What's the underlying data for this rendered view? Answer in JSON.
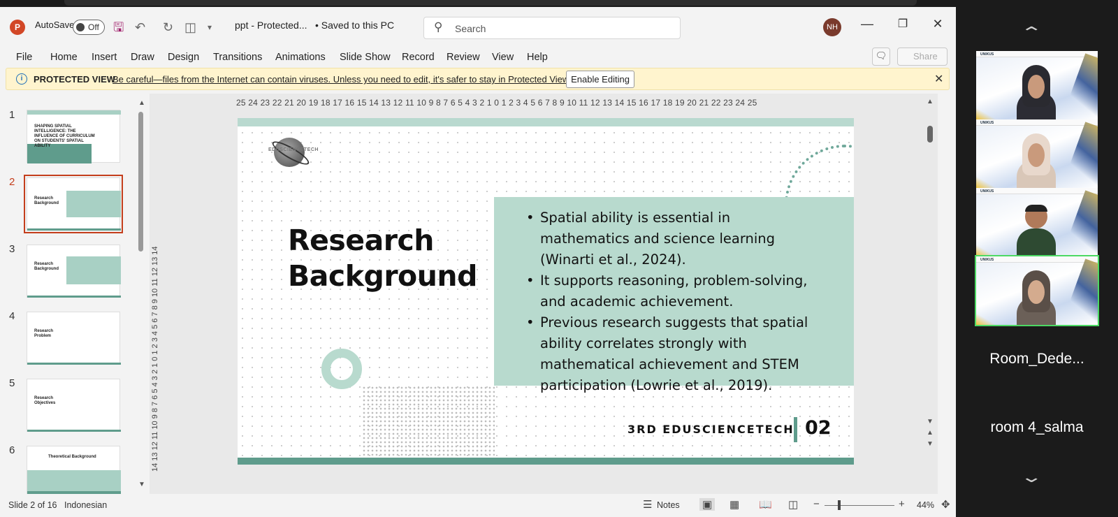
{
  "app": {
    "logo_letter": "P",
    "autosave_label": "AutoSave",
    "autosave_state": "Off",
    "filename": "ppt - Protected...",
    "save_status": "• Saved to this PC",
    "search_placeholder": "Search",
    "user_initials": "NH"
  },
  "ribbon": {
    "tabs": [
      "File",
      "Home",
      "Insert",
      "Draw",
      "Design",
      "Transitions",
      "Animations",
      "Slide Show",
      "Record",
      "Review",
      "View",
      "Help"
    ],
    "share_label": "Share"
  },
  "protected_bar": {
    "title": "PROTECTED VIEW",
    "message": "Be careful—files from the Internet can contain viruses. Unless you need to edit, it's safer to stay in Protected View.",
    "button": "Enable Editing"
  },
  "rulers": {
    "horizontal": "25 24 23 22 21 20 19 18 17 16 15 14 13 12 11 10 9 8 7 6 5 4 3 2 1 0 1 2 3 4 5 6 7 8 9 10 11 12 13 14 15 16 17 18 19 20 21 22 23 24 25",
    "vertical": "14 13 12 11 10 9 8 7 6 5 4 3 2 1 0 1 2 3 4 5 6 7 8 9 10 11 12 13 14"
  },
  "thumbnails": [
    {
      "num": "1",
      "title": "SHAPING SPATIAL INTELLIGENCE: THE INFLUENCE OF CURRICULUM ON STUDENTS' SPATIAL ABILITY",
      "selected": false
    },
    {
      "num": "2",
      "title": "Research Background",
      "selected": true
    },
    {
      "num": "3",
      "title": "Research Background",
      "selected": false
    },
    {
      "num": "4",
      "title": "Research Problem",
      "selected": false
    },
    {
      "num": "5",
      "title": "Research Objectives",
      "selected": false
    },
    {
      "num": "6",
      "title": "Theoretical Background",
      "selected": false
    }
  ],
  "slide": {
    "title_line1": "Research",
    "title_line2": "Background",
    "logo_text": "EDUSCIENCETECH",
    "bullets": [
      "Spatial ability is essential in mathematics and science learning (Winarti et al., 2024).",
      "It supports reasoning, problem-solving, and academic achievement.",
      "Previous research suggests that spatial ability correlates strongly with mathematical achievement and STEM participation (Lowrie et al., 2019)."
    ],
    "footer": "3RD EDUSCIENCETECH",
    "page": "02"
  },
  "status": {
    "slide_info": "Slide 2 of 16",
    "language": "Indonesian",
    "notes": "Notes",
    "zoom": "44%"
  },
  "meeting": {
    "banner_text": "UNIKUS",
    "names": [
      "Room_Dede...",
      "room 4_salma"
    ]
  },
  "colors": {
    "accent_green": "#5f9c8c",
    "light_green": "#b8dace",
    "selected_thumb": "#c43e1c",
    "active_speaker": "#4cd964"
  }
}
